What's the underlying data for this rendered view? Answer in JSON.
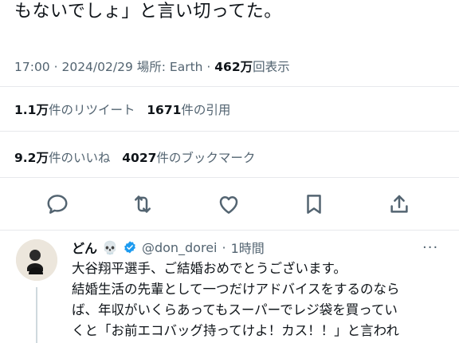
{
  "tweet": {
    "text_tail": "もないでしょ」と言い切ってた。",
    "time": "17:00",
    "date": "2024/02/29",
    "place_label": "場所: Earth",
    "views_value": "462万",
    "views_label": "回表示"
  },
  "stats": {
    "retweets_value": "1.1万",
    "retweets_label": "件のリツイート",
    "quotes_value": "1671",
    "quotes_label": "件の引用",
    "likes_value": "9.2万",
    "likes_label": "件のいいね",
    "bookmarks_value": "4027",
    "bookmarks_label": "件のブックマーク"
  },
  "actions": [
    "reply-icon",
    "retweet-icon",
    "like-icon",
    "bookmark-icon",
    "share-icon"
  ],
  "reply": {
    "name": "どん",
    "name_emoji": "💀",
    "handle": "@don_dorei",
    "time": "1時間",
    "more": "···",
    "lines": [
      "大谷翔平選手、ご結婚おめでとうございます。",
      "結婚生活の先輩として一つだけアドバイスをするのなら",
      "ば、年収がいくらあってもスーパーでレジ袋を買ってい",
      "くと「お前エコバッグ持ってけよ！カス！！」と言われ"
    ]
  },
  "colors": {
    "text": "#0f1419",
    "secondary": "#536471",
    "divider": "#e7e9ec",
    "verified": "#1d9bf0"
  }
}
